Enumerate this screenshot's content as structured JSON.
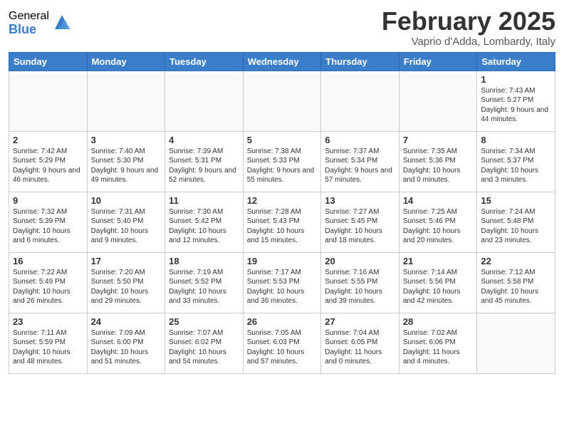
{
  "logo": {
    "general": "General",
    "blue": "Blue"
  },
  "header": {
    "month": "February 2025",
    "location": "Vaprio d'Adda, Lombardy, Italy"
  },
  "weekdays": [
    "Sunday",
    "Monday",
    "Tuesday",
    "Wednesday",
    "Thursday",
    "Friday",
    "Saturday"
  ],
  "weeks": [
    [
      {
        "day": "",
        "info": ""
      },
      {
        "day": "",
        "info": ""
      },
      {
        "day": "",
        "info": ""
      },
      {
        "day": "",
        "info": ""
      },
      {
        "day": "",
        "info": ""
      },
      {
        "day": "",
        "info": ""
      },
      {
        "day": "1",
        "info": "Sunrise: 7:43 AM\nSunset: 5:27 PM\nDaylight: 9 hours and 44 minutes."
      }
    ],
    [
      {
        "day": "2",
        "info": "Sunrise: 7:42 AM\nSunset: 5:29 PM\nDaylight: 9 hours and 46 minutes."
      },
      {
        "day": "3",
        "info": "Sunrise: 7:40 AM\nSunset: 5:30 PM\nDaylight: 9 hours and 49 minutes."
      },
      {
        "day": "4",
        "info": "Sunrise: 7:39 AM\nSunset: 5:31 PM\nDaylight: 9 hours and 52 minutes."
      },
      {
        "day": "5",
        "info": "Sunrise: 7:38 AM\nSunset: 5:33 PM\nDaylight: 9 hours and 55 minutes."
      },
      {
        "day": "6",
        "info": "Sunrise: 7:37 AM\nSunset: 5:34 PM\nDaylight: 9 hours and 57 minutes."
      },
      {
        "day": "7",
        "info": "Sunrise: 7:35 AM\nSunset: 5:36 PM\nDaylight: 10 hours and 0 minutes."
      },
      {
        "day": "8",
        "info": "Sunrise: 7:34 AM\nSunset: 5:37 PM\nDaylight: 10 hours and 3 minutes."
      }
    ],
    [
      {
        "day": "9",
        "info": "Sunrise: 7:32 AM\nSunset: 5:39 PM\nDaylight: 10 hours and 6 minutes."
      },
      {
        "day": "10",
        "info": "Sunrise: 7:31 AM\nSunset: 5:40 PM\nDaylight: 10 hours and 9 minutes."
      },
      {
        "day": "11",
        "info": "Sunrise: 7:30 AM\nSunset: 5:42 PM\nDaylight: 10 hours and 12 minutes."
      },
      {
        "day": "12",
        "info": "Sunrise: 7:28 AM\nSunset: 5:43 PM\nDaylight: 10 hours and 15 minutes."
      },
      {
        "day": "13",
        "info": "Sunrise: 7:27 AM\nSunset: 5:45 PM\nDaylight: 10 hours and 18 minutes."
      },
      {
        "day": "14",
        "info": "Sunrise: 7:25 AM\nSunset: 5:46 PM\nDaylight: 10 hours and 20 minutes."
      },
      {
        "day": "15",
        "info": "Sunrise: 7:24 AM\nSunset: 5:48 PM\nDaylight: 10 hours and 23 minutes."
      }
    ],
    [
      {
        "day": "16",
        "info": "Sunrise: 7:22 AM\nSunset: 5:49 PM\nDaylight: 10 hours and 26 minutes."
      },
      {
        "day": "17",
        "info": "Sunrise: 7:20 AM\nSunset: 5:50 PM\nDaylight: 10 hours and 29 minutes."
      },
      {
        "day": "18",
        "info": "Sunrise: 7:19 AM\nSunset: 5:52 PM\nDaylight: 10 hours and 33 minutes."
      },
      {
        "day": "19",
        "info": "Sunrise: 7:17 AM\nSunset: 5:53 PM\nDaylight: 10 hours and 36 minutes."
      },
      {
        "day": "20",
        "info": "Sunrise: 7:16 AM\nSunset: 5:55 PM\nDaylight: 10 hours and 39 minutes."
      },
      {
        "day": "21",
        "info": "Sunrise: 7:14 AM\nSunset: 5:56 PM\nDaylight: 10 hours and 42 minutes."
      },
      {
        "day": "22",
        "info": "Sunrise: 7:12 AM\nSunset: 5:58 PM\nDaylight: 10 hours and 45 minutes."
      }
    ],
    [
      {
        "day": "23",
        "info": "Sunrise: 7:11 AM\nSunset: 5:59 PM\nDaylight: 10 hours and 48 minutes."
      },
      {
        "day": "24",
        "info": "Sunrise: 7:09 AM\nSunset: 6:00 PM\nDaylight: 10 hours and 51 minutes."
      },
      {
        "day": "25",
        "info": "Sunrise: 7:07 AM\nSunset: 6:02 PM\nDaylight: 10 hours and 54 minutes."
      },
      {
        "day": "26",
        "info": "Sunrise: 7:05 AM\nSunset: 6:03 PM\nDaylight: 10 hours and 57 minutes."
      },
      {
        "day": "27",
        "info": "Sunrise: 7:04 AM\nSunset: 6:05 PM\nDaylight: 11 hours and 0 minutes."
      },
      {
        "day": "28",
        "info": "Sunrise: 7:02 AM\nSunset: 6:06 PM\nDaylight: 11 hours and 4 minutes."
      },
      {
        "day": "",
        "info": ""
      }
    ]
  ]
}
